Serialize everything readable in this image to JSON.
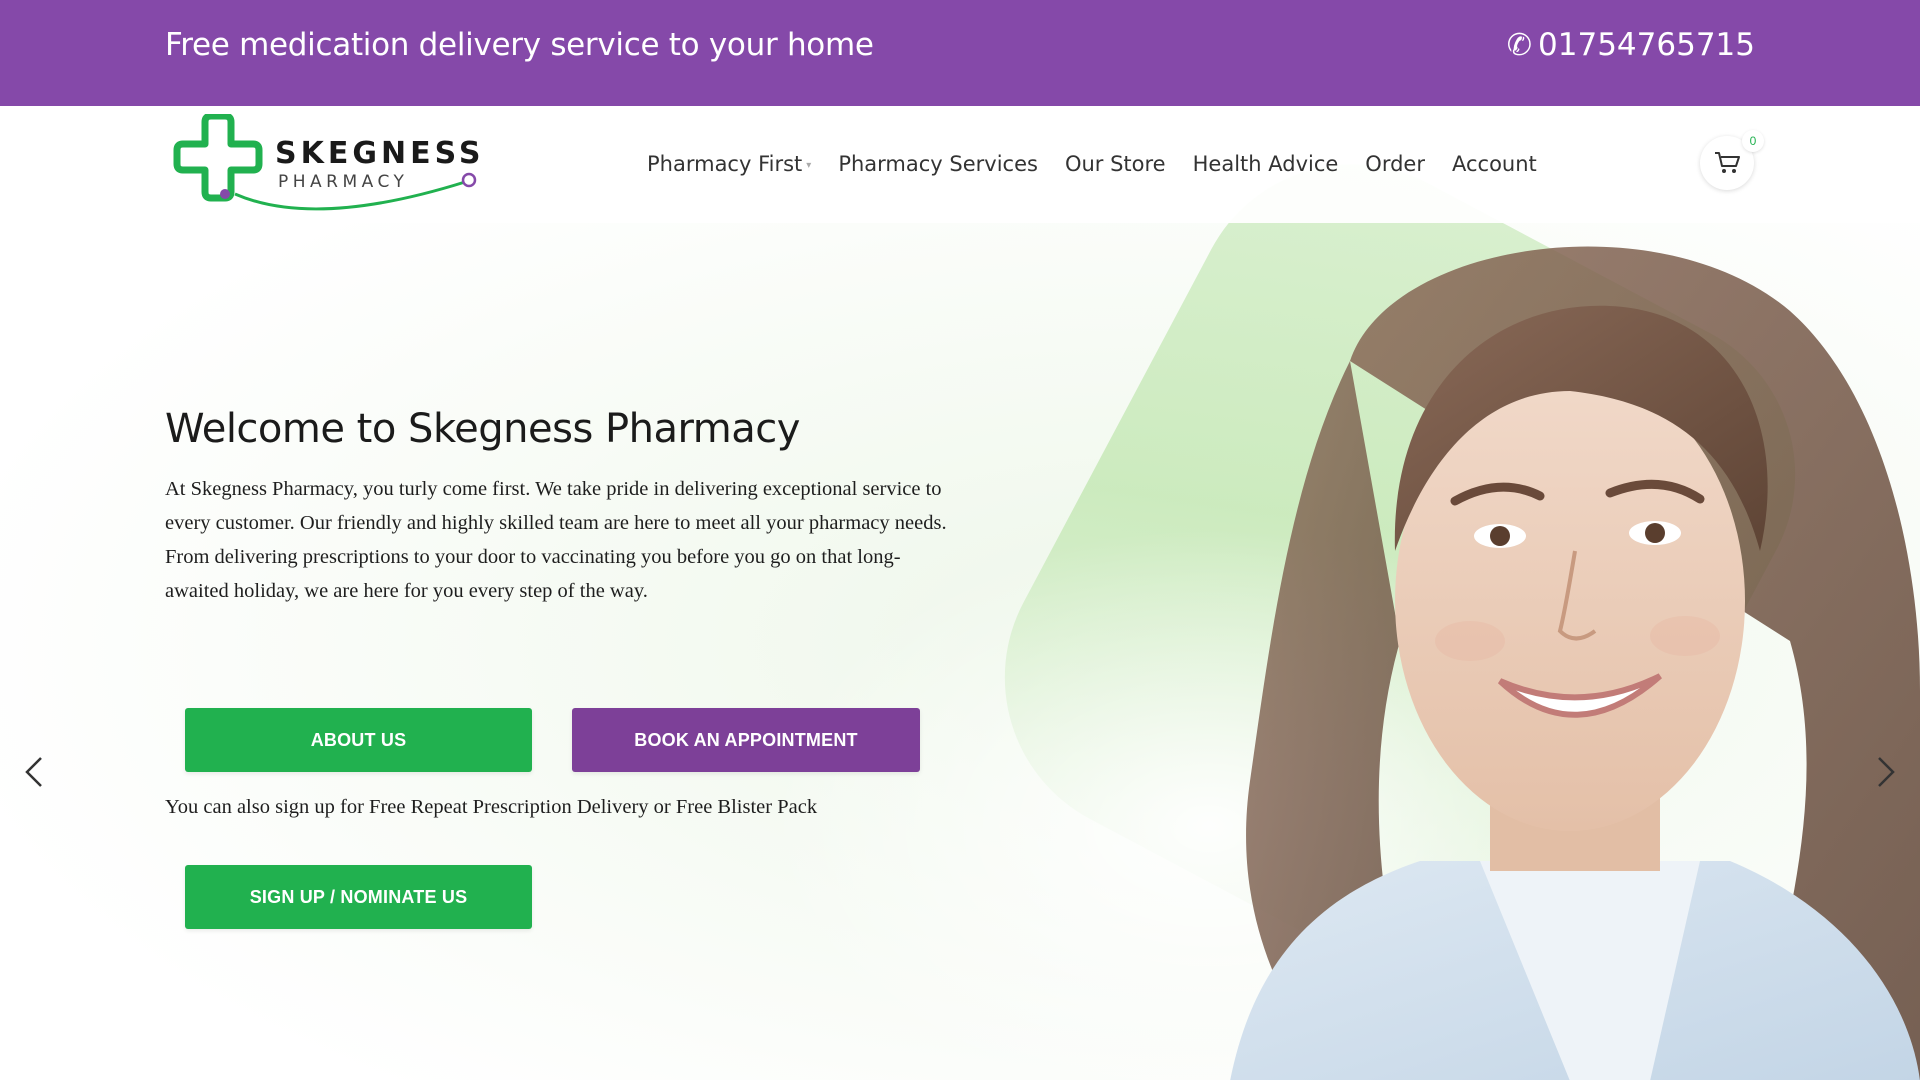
{
  "topbar": {
    "promo": "Free medication delivery service to your home",
    "phone_icon": "phone-icon",
    "phone": "01754765715",
    "background": "#8549a9"
  },
  "header": {
    "logo": {
      "word1": "SKEGNESS",
      "word2": "PHARMACY"
    },
    "nav": [
      {
        "label": "Pharmacy First",
        "has_dropdown": true
      },
      {
        "label": "Pharmacy Services"
      },
      {
        "label": "Our Store"
      },
      {
        "label": "Health Advice"
      },
      {
        "label": "Order"
      },
      {
        "label": "Account"
      }
    ],
    "cart": {
      "icon": "cart-icon",
      "count": "0"
    }
  },
  "hero": {
    "title": "Welcome to Skegness Pharmacy",
    "text": "At Skegness Pharmacy, you turly come first. We take pride in delivering exceptional service to every customer. Our friendly and highly skilled team are here to meet all your pharmacy needs. From delivering prescriptions to your door to vaccinating you before you go on that long-awaited holiday, we are here for you every step of the way.",
    "buttons": {
      "about": "ABOUT US",
      "book": "BOOK AN APPOINTMENT",
      "signup": "SIGN UP / NOMINATE US"
    },
    "signup_text": "You can also sign up for Free Repeat Prescription Delivery or Free Blister Pack",
    "prev_icon": "chevron-left-icon",
    "next_icon": "chevron-right-icon"
  },
  "colors": {
    "brand_purple": "#8549a9",
    "brand_green": "#21b14f",
    "button_purple": "#7d4098"
  }
}
